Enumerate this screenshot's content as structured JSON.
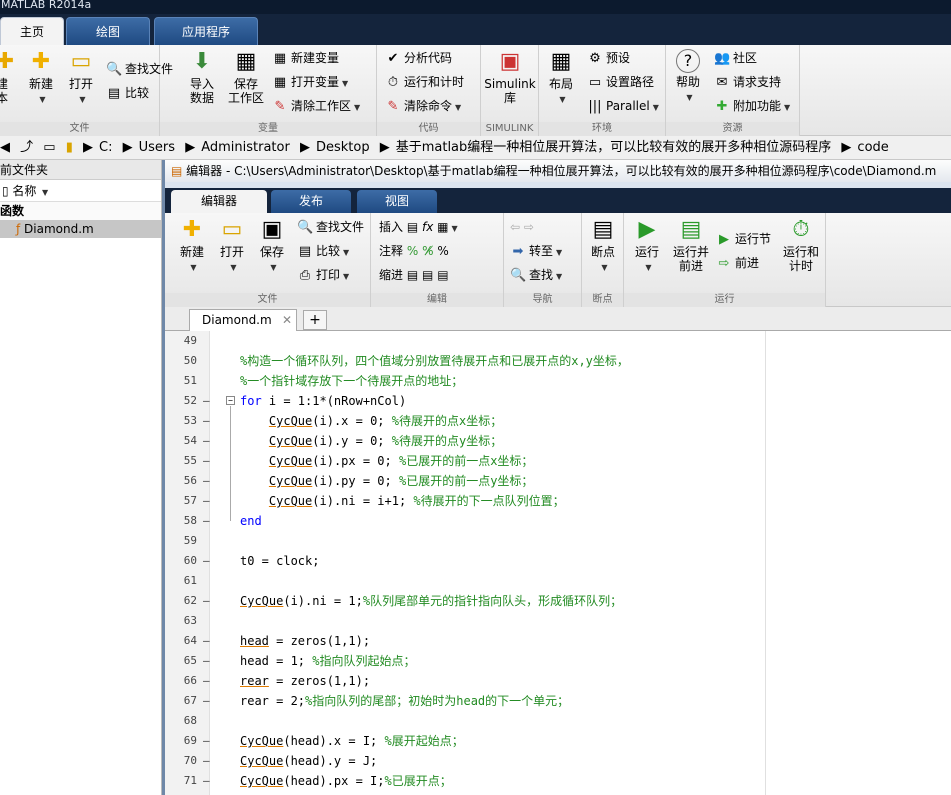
{
  "app_title": "MATLAB R2014a",
  "main_tabs": [
    {
      "label": "主页"
    },
    {
      "label": "绘图"
    },
    {
      "label": "应用程序"
    }
  ],
  "ribbon": {
    "new_script_partial": "建\n本",
    "new_label": "新建",
    "open_label": "打开",
    "find_files": "查找文件",
    "compare": "比较",
    "file_section": "文件",
    "import_data": "导入\n数据",
    "save_workspace": "保存\n工作区",
    "new_variable": "新建变量",
    "open_variable": "打开变量",
    "clear_workspace": "清除工作区",
    "variable_section": "变量",
    "analyze_code": "分析代码",
    "run_and_time": "运行和计时",
    "clear_commands": "清除命令",
    "code_section": "代码",
    "simulink_library": "Simulink\n库",
    "simulink_section": "SIMULINK",
    "layout": "布局",
    "preferences": "预设",
    "set_path": "设置路径",
    "parallel": "Parallel",
    "environment_section": "环境",
    "help": "帮助",
    "community": "社区",
    "request_support": "请求支持",
    "add_ons": "附加功能",
    "resources_section": "资源"
  },
  "address": {
    "segments": [
      "C:",
      "Users",
      "Administrator",
      "Desktop",
      "基于matlab编程一种相位展开算法，可以比较有效的展开多种相位源码程序",
      "code"
    ]
  },
  "current_folder": {
    "title": "前文件夹",
    "name_header": "名称",
    "group": "函数",
    "files": [
      {
        "name": "Diamond.m"
      }
    ]
  },
  "editor": {
    "title": "编辑器 - C:\\Users\\Administrator\\Desktop\\基于matlab编程一种相位展开算法，可以比较有效的展开多种相位源码程序\\code\\Diamond.m",
    "tabs": [
      {
        "label": "编辑器"
      },
      {
        "label": "发布"
      },
      {
        "label": "视图"
      }
    ],
    "ribbon": {
      "new": "新建",
      "open": "打开",
      "save": "保存",
      "find_files": "查找文件",
      "compare": "比较",
      "print": "打印",
      "file_section": "文件",
      "insert": "插入",
      "comment": "注释",
      "indent": "缩进",
      "fx": "fx",
      "edit_section": "编辑",
      "goto": "转至",
      "find": "查找",
      "navigate_section": "导航",
      "breakpoints": "断点",
      "breakpoints_section": "断点",
      "run": "运行",
      "run_advance": "运行并\n前进",
      "run_section": "运行节",
      "advance": "前进",
      "run_time": "运行和\n计时",
      "run_group_section": "运行"
    },
    "doc_tab": "Diamond.m",
    "plus": "+",
    "lines": [
      {
        "n": "49",
        "dash": "",
        "code": ""
      },
      {
        "n": "50",
        "dash": "",
        "code": "%构造一个循环队列，四个值域分别放置待展开点和已展开点的x,y坐标，"
      },
      {
        "n": "51",
        "dash": "",
        "code": "%一个指针域存放下一个待展开点的地址；"
      },
      {
        "n": "52",
        "dash": "–",
        "code": "for i = 1:1*(nRow+nCol)"
      },
      {
        "n": "53",
        "dash": "–",
        "code": "    CycQue(i).x = 0; %待展开的点x坐标；"
      },
      {
        "n": "54",
        "dash": "–",
        "code": "    CycQue(i).y = 0; %待展开的点y坐标；"
      },
      {
        "n": "55",
        "dash": "–",
        "code": "    CycQue(i).px = 0; %已展开的前一点x坐标；"
      },
      {
        "n": "56",
        "dash": "–",
        "code": "    CycQue(i).py = 0; %已展开的前一点y坐标；"
      },
      {
        "n": "57",
        "dash": "–",
        "code": "    CycQue(i).ni = i+1; %待展开的下一点队列位置；"
      },
      {
        "n": "58",
        "dash": "–",
        "code": "end"
      },
      {
        "n": "59",
        "dash": "",
        "code": ""
      },
      {
        "n": "60",
        "dash": "–",
        "code": "t0 = clock;"
      },
      {
        "n": "61",
        "dash": "",
        "code": ""
      },
      {
        "n": "62",
        "dash": "–",
        "code": "CycQue(i).ni = 1;%队列尾部单元的指针指向队头，形成循环队列；"
      },
      {
        "n": "63",
        "dash": "",
        "code": ""
      },
      {
        "n": "64",
        "dash": "–",
        "code": "head = zeros(1,1);"
      },
      {
        "n": "65",
        "dash": "–",
        "code": "head = 1; %指向队列起始点；"
      },
      {
        "n": "66",
        "dash": "–",
        "code": "rear = zeros(1,1);"
      },
      {
        "n": "67",
        "dash": "–",
        "code": "rear = 2;%指向队列的尾部；初始时为head的下一个单元；"
      },
      {
        "n": "68",
        "dash": "",
        "code": ""
      },
      {
        "n": "69",
        "dash": "–",
        "code": "CycQue(head).x = I; %展开起始点；"
      },
      {
        "n": "70",
        "dash": "–",
        "code": "CycQue(head).y = J;"
      },
      {
        "n": "71",
        "dash": "–",
        "code": "CycQue(head).px = I;%已展开点；"
      }
    ]
  }
}
